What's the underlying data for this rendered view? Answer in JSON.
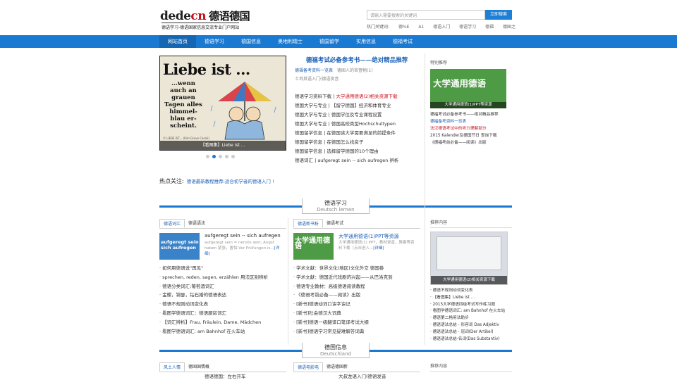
{
  "header": {
    "logo_en_1": "dede",
    "logo_en_2": "cn",
    "logo_cn": "德语德国",
    "slogan": "德语学习-德语国家信息交流专业门户网站",
    "search_placeholder": "请输入需要搜索的关键词",
    "search_button": "立即搜索",
    "hot_label": "热门关键词:",
    "hot_keywords": [
      "德%E",
      "A1",
      "德语入门",
      "德语学习",
      "德福",
      "德国之"
    ]
  },
  "nav": [
    "网站首页",
    "德语学习",
    "德国信息",
    "奥地利瑞士",
    "德国留学",
    "实用信息",
    "德福考试"
  ],
  "slider": {
    "title": "Liebe ist ...",
    "poem": "...wenn auch an grauen Tagen alles himmel- blau er- scheint.",
    "credit": "© LIEBE IST... (Kim Grove Casali)",
    "caption": "【看图集】Liebe ist ...",
    "dots": 5,
    "active": 2
  },
  "center": {
    "headline": "德福考试必备参考书——绝对精品推荐",
    "row1_a": "德福备考资料一览表",
    "row1_b": "德国人的吝啬物(1)",
    "row2": "土耳其语入门(德语发音",
    "items": [
      {
        "cat": "德语学习资料下载",
        "title": "大学通用德语(2)相关资源下载",
        "hot": true
      },
      {
        "cat": "德国大学与专业",
        "title": "【留学德国】经济和体育专业"
      },
      {
        "cat": "德国大学与专业",
        "title": "德国学位及专业课程设置"
      },
      {
        "cat": "德国大学与专业",
        "title": "德国高校类型Hochschultypen"
      },
      {
        "cat": "德国留学信息",
        "title": "在德国读大学需要满足的前提条件"
      },
      {
        "cat": "德国留学信息",
        "title": "在德国怎么找房子"
      },
      {
        "cat": "德国留学信息",
        "title": "选择留学德国的10个理由"
      },
      {
        "cat": "德语词汇",
        "title": "aufgeregt sein -- sich aufregen 辨析"
      }
    ]
  },
  "recommend": {
    "title": "特别推荐",
    "image_title": "大学通用德语",
    "image_caption": "大学通用德语(1)PPT等资源",
    "items": [
      "德福考试必备参考书——绝对精品推荐",
      "德福备考资料一览表",
      "法汉德语考试中的听力理解部分",
      "2015 Kalender及德国节日 查询下载",
      "《德福考前必备——阅读》出版"
    ]
  },
  "hot_line": {
    "label": "热点关注:",
    "text": "德语最新教程推荐:适合初学者的德语入门 !"
  },
  "section1": {
    "cn": "德语学习",
    "en": "Deutsch lernen"
  },
  "section2": {
    "cn": "德国信息",
    "en": "Deutschland"
  },
  "col1": {
    "tabs": [
      "德语词汇",
      "德语语法"
    ],
    "thumb_text": "aufgeregt sein sich aufregen",
    "feat_title": "aufgeregt sein -- sich aufregen",
    "feat_desc": "aufgeregt sein = nervös sein; Angst haben 紧张，害怕 Vor Prüfungen is...",
    "more": "[详细]",
    "items": [
      "如何用德语说\"再见\"",
      "sprechen, reden, sagen, erzählen 用法区别辨析",
      "德语分类词汇:葡萄酒词汇",
      "金蝶，锦瑟，钻石婚的德语表达",
      "德语不规则动词变化表",
      "看图学德语词汇：德语厨房词汇",
      "【词汇辨析】Frau, Fräulein, Dame, Mädchen",
      "看图学德语词汇: am Bahnhof 在火车站"
    ]
  },
  "col2": {
    "tabs": [
      "德语新书析",
      "德语考试"
    ],
    "thumb_text": "大学通用德语",
    "feat_title": "大学通用德语(1)PPT等资源",
    "feat_desc": "大学通用德语(1) PPT，教材录音，教案等资料下载（点击进入...",
    "more": "[详细]",
    "items": [
      "学术文献：世界文化(地区)文化外交 德国卷",
      "学术文献：德国近代戏剧的兴起——从巴洛克到",
      "德语专业教材：高级德语阅读教程",
      "《德语考前必备——阅读》出版",
      "[新书]德语动词口诀字诀记",
      "[新书]社会德汉大词典",
      "[新书]德语一级翻译口笔译考试大纲",
      "[新书]德语学习常见疑难解答词典"
    ]
  },
  "col3": {
    "title": "推荐内容",
    "caption": "大学通用德语(2)相关资源下载",
    "items": [
      "德语不规则动词变化表",
      "【看图集】Liebe ist ...",
      "2015大学德语四级考试写作练习题",
      "看图学德语词汇: am Bahnhof 在火车站",
      "德语第二格用法助步",
      "德语语法总结 - 形容词 Das Adjektiv",
      "德语语法总结 - 冠词(Der Artikel)",
      "德语语法总结-名词(Das Substantiv)"
    ]
  },
  "col4": {
    "tabs": [
      "风土人情",
      "德国国情概"
    ],
    "peek": "德语德国：左右开车"
  },
  "col5": {
    "tabs": [
      "德语电影电",
      "德语德国新"
    ],
    "peek": "大叔龙语入门(德语发音"
  },
  "col6": {
    "title": "推荐内容"
  },
  "colors": {
    "nav": "#1a79d0",
    "brand_red": "#c8101c",
    "link": "#1a5fb4"
  }
}
